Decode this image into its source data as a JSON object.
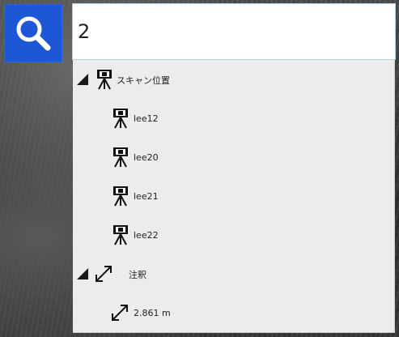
{
  "search": {
    "query": "2",
    "button_icon": "search-icon"
  },
  "results": {
    "groups": [
      {
        "label": "スキャン位置",
        "icon": "scanner-tripod-icon",
        "items": [
          {
            "label": "lee12",
            "icon": "scanner-tripod-icon"
          },
          {
            "label": "lee20",
            "icon": "scanner-tripod-icon"
          },
          {
            "label": "lee21",
            "icon": "scanner-tripod-icon"
          },
          {
            "label": "lee22",
            "icon": "scanner-tripod-icon"
          }
        ]
      },
      {
        "label": "注釈",
        "icon": "measure-arrow-icon",
        "items": [
          {
            "label": "2.861 m",
            "icon": "measure-arrow-icon"
          }
        ]
      }
    ]
  },
  "colors": {
    "search_button": "#1d57d6",
    "dropdown_bg": "#ececec",
    "input_border": "#b8cfe0"
  }
}
